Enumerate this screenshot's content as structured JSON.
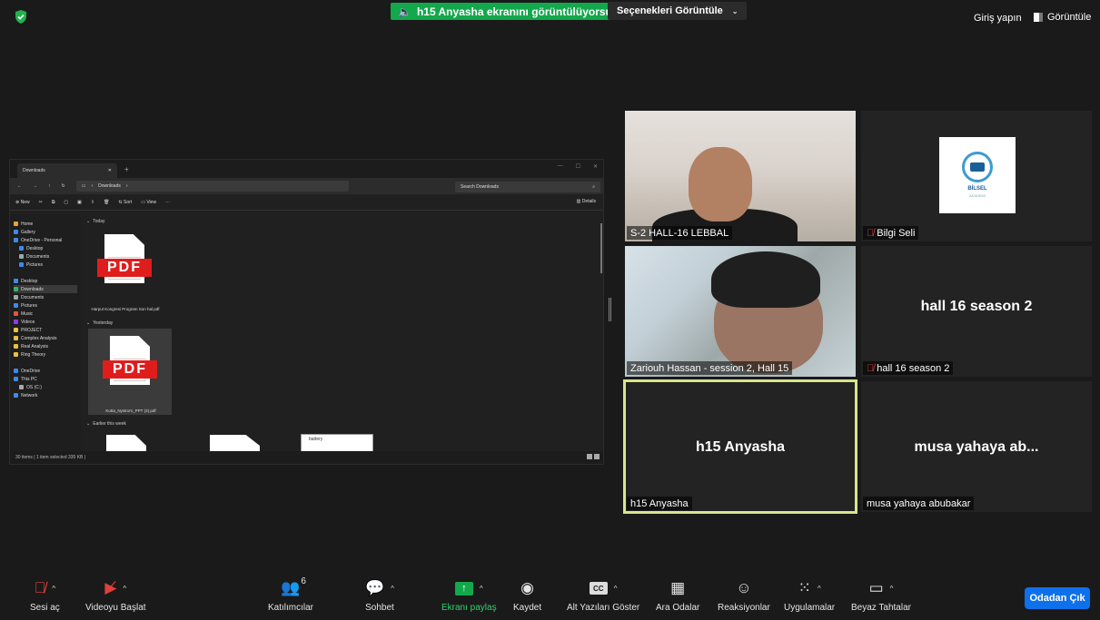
{
  "topbar": {
    "share_banner": "h15 Anyasha ekranını görüntülüyorsunuz",
    "view_options": "Seçenekleri Görüntüle",
    "signin": "Giriş yapın",
    "view": "Görüntüle"
  },
  "explorer": {
    "tab_title": "Downloads",
    "path": "Downloads",
    "search_placeholder": "Search Downloads",
    "cmd": {
      "new": "New",
      "sort": "Sort",
      "view": "View",
      "more": "···",
      "details": "Details"
    },
    "sidebar": [
      {
        "label": "Home",
        "color": "#e8a33d"
      },
      {
        "label": "Gallery",
        "color": "#3d8be8"
      },
      {
        "label": "OneDrive - Personal",
        "color": "#3d8be8"
      },
      {
        "label": "Desktop",
        "color": "#3d8be8",
        "indent": true
      },
      {
        "label": "Documents",
        "color": "#9aa",
        "indent": true
      },
      {
        "label": "Pictures",
        "color": "#3d8be8",
        "indent": true
      },
      {
        "label": "",
        "color": ""
      },
      {
        "label": "Desktop",
        "color": "#3d8be8"
      },
      {
        "label": "Downloads",
        "color": "#2fb56b",
        "selected": true
      },
      {
        "label": "Documents",
        "color": "#9aa"
      },
      {
        "label": "Pictures",
        "color": "#3d8be8"
      },
      {
        "label": "Music",
        "color": "#e8533d"
      },
      {
        "label": "Videos",
        "color": "#8a3de8"
      },
      {
        "label": "PROJECT",
        "color": "#e8c23d"
      },
      {
        "label": "Complex Analysis",
        "color": "#e8c23d"
      },
      {
        "label": "Real Analysis",
        "color": "#e8c23d"
      },
      {
        "label": "Ring Theory",
        "color": "#e8c23d"
      },
      {
        "label": "",
        "color": ""
      },
      {
        "label": "OneDrive",
        "color": "#3d8be8"
      },
      {
        "label": "This PC",
        "color": "#3d8be8"
      },
      {
        "label": "OS (C:)",
        "color": "#aaa",
        "indent": true
      },
      {
        "label": "Network",
        "color": "#3d8be8"
      }
    ],
    "groups": {
      "today": "Today",
      "yesterday": "Yesterday",
      "earlier": "Earlier this week"
    },
    "files": [
      {
        "name": "Harput Kongresi Program Son hal.pdf",
        "badge": "PDF"
      },
      {
        "name": "Kutta_Nystrom_PPT (2).pdf",
        "badge": "PDF"
      }
    ],
    "thumb_text": "battery",
    "status": "30 items  |  1 item selected  335 KB  |"
  },
  "participants": [
    {
      "name": "S-2 HALL-16 LEBBAL",
      "muted": false
    },
    {
      "name": "Bilgi Seli",
      "muted": true,
      "logo_title": "BİLSEL",
      "logo_sub": "AKADEMİ"
    },
    {
      "name": "Zariouh Hassan - session 2, Hall 15",
      "muted": false
    },
    {
      "name": "hall 16 season 2",
      "muted": true,
      "big_label": "hall 16 season 2"
    },
    {
      "name": "h15 Anyasha",
      "muted": false,
      "big_label": "h15 Anyasha"
    },
    {
      "name": "musa yahaya abubakar",
      "muted": false,
      "big_label": "musa yahaya ab..."
    }
  ],
  "toolbar": {
    "audio": "Sesi aç",
    "video": "Videoyu Başlat",
    "participants": "Katılımcılar",
    "participants_count": "6",
    "chat": "Sohbet",
    "share": "Ekranı paylaş",
    "record": "Kaydet",
    "captions": "Alt Yazıları Göster",
    "captions_icon": "CC",
    "breakout": "Ara Odalar",
    "reactions": "Reaksiyonlar",
    "apps": "Uygulamalar",
    "whiteboard": "Beyaz Tahtalar",
    "leave": "Odadan Çık"
  },
  "colors": {
    "share_green": "#12a84b",
    "leave_blue": "#0e71eb",
    "active_speaker": "#d9e58a",
    "muted_red": "#e0403a"
  }
}
